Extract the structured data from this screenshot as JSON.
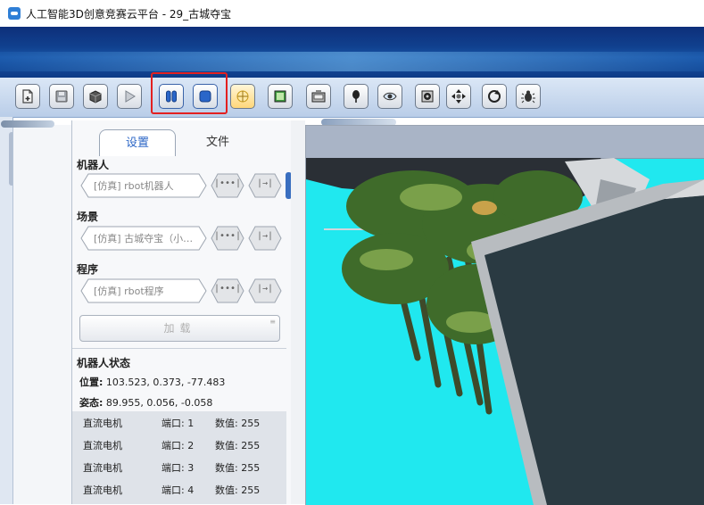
{
  "window": {
    "title": "人工智能3D创意竞赛云平台 - 29_古城夺宝"
  },
  "toolbar": {
    "buttons": [
      {
        "name": "new-file-icon"
      },
      {
        "name": "save-icon"
      },
      {
        "name": "box-icon"
      },
      {
        "name": "play-icon"
      },
      {
        "name": "pause-icon"
      },
      {
        "name": "stop-icon"
      },
      {
        "name": "move-view-icon"
      },
      {
        "name": "picture-icon"
      },
      {
        "name": "camera-icon"
      },
      {
        "name": "tree-icon"
      },
      {
        "name": "eye-view-icon"
      },
      {
        "name": "gear-icon"
      },
      {
        "name": "direction-icon"
      },
      {
        "name": "rotate-icon"
      },
      {
        "name": "bug-icon"
      }
    ],
    "highlight_color": "#e32020"
  },
  "panel": {
    "tabs": [
      {
        "label": "设置",
        "active": true
      },
      {
        "label": "文件",
        "active": false
      }
    ],
    "robot": {
      "title": "机器人",
      "value": "[仿真] rbot机器人"
    },
    "scene": {
      "title": "场景",
      "value": "[仿真] 古城夺宝（小…"
    },
    "program": {
      "title": "程序",
      "value": "[仿真] rbot程序"
    },
    "hex_buttons": {
      "dots": "|•••|",
      "arrow": "|→|"
    },
    "load_label": "加载",
    "status": {
      "title": "机器人状态",
      "position_label": "位置:",
      "position_value": "103.523, 0.373, -77.483",
      "attitude_label": "姿态:",
      "attitude_value": "89.955, 0.056, -0.058",
      "motors": [
        {
          "type": "直流电机",
          "port_label": "端口:",
          "port": "1",
          "value_label": "数值:",
          "value": "255"
        },
        {
          "type": "直流电机",
          "port_label": "端口:",
          "port": "2",
          "value_label": "数值:",
          "value": "255"
        },
        {
          "type": "直流电机",
          "port_label": "端口:",
          "port": "3",
          "value_label": "数值:",
          "value": "255"
        },
        {
          "type": "直流电机",
          "port_label": "端口:",
          "port": "4",
          "value_label": "数值:",
          "value": "255"
        }
      ]
    }
  },
  "viewport": {
    "background_color": "#20e8ef"
  }
}
